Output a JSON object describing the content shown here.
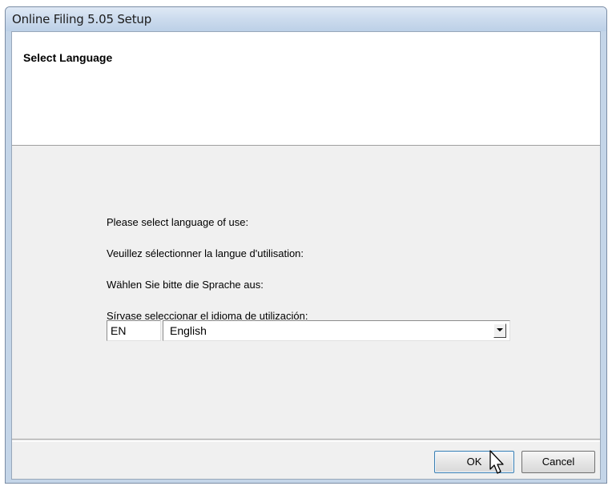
{
  "window": {
    "title": "Online Filing 5.05 Setup"
  },
  "header": {
    "title": "Select Language"
  },
  "prompts": [
    "Please select language of use:",
    "Veuillez sélectionner la langue d'utilisation:",
    "Wählen Sie bitte die Sprache aus:",
    "Sírvase seleccionar el idioma de utilización:"
  ],
  "language": {
    "code": "EN",
    "selected": "English"
  },
  "buttons": {
    "ok": "OK",
    "cancel": "Cancel"
  },
  "icons": {
    "dropdown": "chevron-down-icon",
    "cursor": "mouse-cursor-icon"
  },
  "colors": {
    "titlebar": "#cddcee",
    "client_bg": "#f0f0f0",
    "header_bg": "#ffffff",
    "default_button_border": "#3c7fb1"
  }
}
